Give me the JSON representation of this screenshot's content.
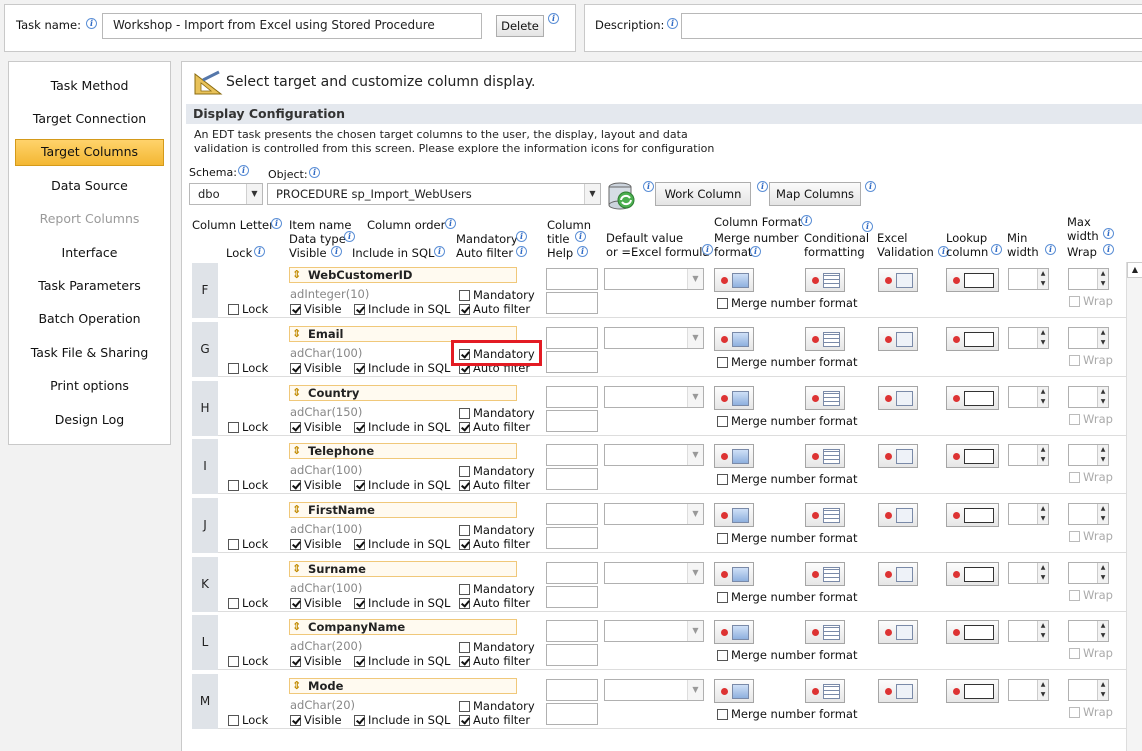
{
  "task": {
    "name_label": "Task name:",
    "name_value": "Workshop - Import from Excel using Stored Procedure",
    "delete_label": "Delete",
    "description_label": "Description:",
    "description_value": ""
  },
  "sidebar": {
    "items": [
      {
        "label": "Task Method"
      },
      {
        "label": "Target Connection"
      },
      {
        "label": "Target Columns"
      },
      {
        "label": "Data Source"
      },
      {
        "label": "Report Columns"
      },
      {
        "label": "Interface"
      },
      {
        "label": "Task Parameters"
      },
      {
        "label": "Batch Operation"
      },
      {
        "label": "Task File & Sharing"
      },
      {
        "label": "Print options"
      },
      {
        "label": "Design Log"
      }
    ]
  },
  "main": {
    "heading": "Select target and customize column display.",
    "section_title": "Display Configuration",
    "description_line1": "An EDT task presents the chosen target columns to the user, the display, layout and data",
    "description_line2": "validation is controlled from this screen.  Please explore the information icons for configuration",
    "schema_label": "Schema:",
    "schema_value": "dbo",
    "object_label": "Object:",
    "object_value": "PROCEDURE sp_Import_WebUsers",
    "work_column_label": "Work Column",
    "map_columns_label": "Map Columns"
  },
  "headers": {
    "column_letter": "Column Letter",
    "lock": "Lock",
    "item_name": "Item name",
    "column_order": "Column order",
    "data_type": "Data type",
    "visible": "Visible",
    "include_in_sql": "Include in SQL",
    "mandatory": "Mandatory",
    "auto_filter": "Auto filter",
    "column_title_1": "Column",
    "column_title_2": "title",
    "help": "Help",
    "default_value_1": "Default value",
    "default_value_2": "or =Excel formula",
    "column_format": "Column Format",
    "merge_number_1": "Merge number",
    "merge_number_2": "format",
    "conditional_1": "Conditional",
    "conditional_2": "formatting",
    "excel_1": "Excel",
    "excel_2": "Validation",
    "lookup_1": "Lookup",
    "lookup_2": "column",
    "min_1": "Min",
    "min_2": "width",
    "max_1": "Max",
    "max_2": "width",
    "wrap": "Wrap"
  },
  "row_labels": {
    "lock": "Lock",
    "mandatory": "Mandatory",
    "visible": "Visible",
    "include_in_sql": "Include in SQL",
    "auto_filter": "Auto filter",
    "merge_number_format": "Merge number format",
    "wrap": "Wrap"
  },
  "rows": [
    {
      "letter": "F",
      "name": "WebCustomerID",
      "type": "adInteger(10)",
      "mandatory": false
    },
    {
      "letter": "G",
      "name": "Email",
      "type": "adChar(100)",
      "mandatory": true
    },
    {
      "letter": "H",
      "name": "Country",
      "type": "adChar(150)",
      "mandatory": false
    },
    {
      "letter": "I",
      "name": "Telephone",
      "type": "adChar(100)",
      "mandatory": false
    },
    {
      "letter": "J",
      "name": "FirstName",
      "type": "adChar(100)",
      "mandatory": false
    },
    {
      "letter": "K",
      "name": "Surname",
      "type": "adChar(100)",
      "mandatory": false
    },
    {
      "letter": "L",
      "name": "CompanyName",
      "type": "adChar(200)",
      "mandatory": false
    },
    {
      "letter": "M",
      "name": "Mode",
      "type": "adChar(20)",
      "mandatory": false
    }
  ]
}
